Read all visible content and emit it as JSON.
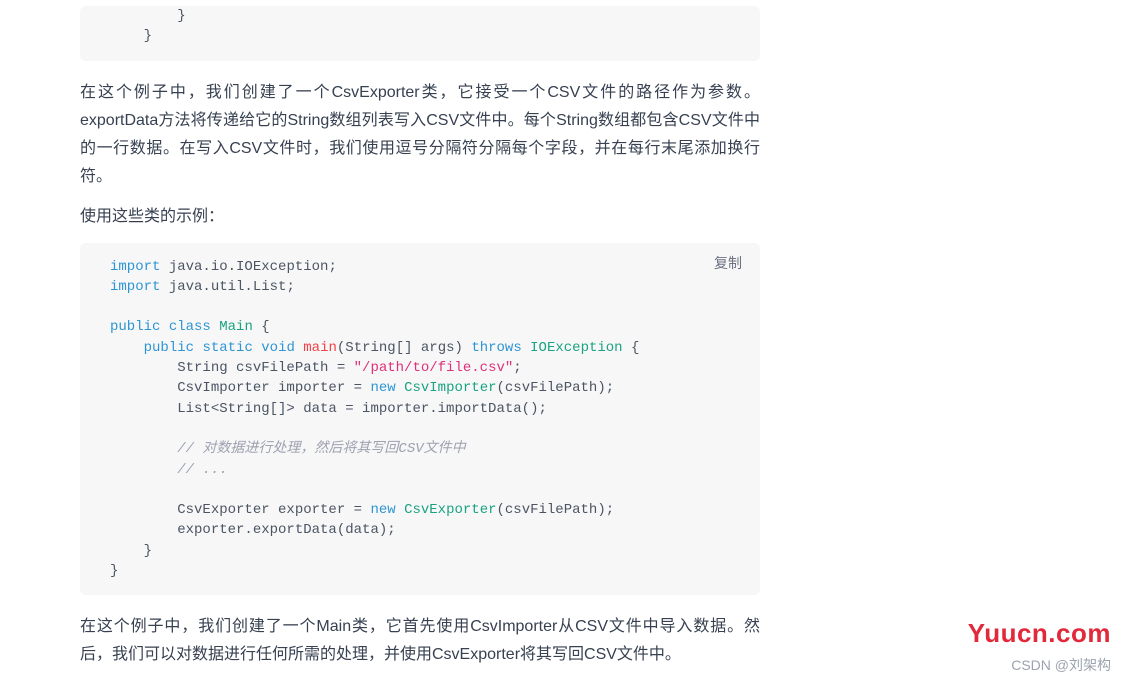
{
  "code1": {
    "l1": "        }",
    "l2": "    }"
  },
  "para1": "在这个例子中，我们创建了一个CsvExporter类，它接受一个CSV文件的路径作为参数。exportData方法将传递给它的String数组列表写入CSV文件中。每个String数组都包含CSV文件中的一行数据。在写入CSV文件时，我们使用逗号分隔符分隔每个字段，并在每行末尾添加换行符。",
  "para2": "使用这些类的示例：",
  "copy_label": "复制",
  "code2": {
    "kw_import": "import",
    "kw_public": "public",
    "kw_class": "class",
    "kw_static": "static",
    "kw_void": "void",
    "kw_throws": "throws",
    "kw_new": "new",
    "import1": " java.io.IOException;",
    "import2": " java.util.List;",
    "cls_main": "Main",
    "fn_main": "main",
    "args": "(String[] args)",
    "ioex": "IOException",
    "brace_open": " {",
    "line5a": "        String csvFilePath = ",
    "str_path": "\"/path/to/file.csv\"",
    "semi": ";",
    "line6a": "        CsvImporter importer = ",
    "cls_importer": "CsvImporter",
    "line6b": "(csvFilePath);",
    "line7": "        List<String[]> data = importer.importData();",
    "cmt1": "        // 对数据进行处理，然后将其写回CSV文件中",
    "cmt2": "        // ...",
    "line11a": "        CsvExporter exporter = ",
    "cls_exporter": "CsvExporter",
    "line11b": "(csvFilePath);",
    "line12": "        exporter.exportData(data);",
    "close1": "    }",
    "close2": "}"
  },
  "para3": "在这个例子中，我们创建了一个Main类，它首先使用CsvImporter从CSV文件中导入数据。然后，我们可以对数据进行任何所需的处理，并使用CsvExporter将其写回CSV文件中。",
  "watermark": "Yuucn.com",
  "attribution": "CSDN @刘架构"
}
